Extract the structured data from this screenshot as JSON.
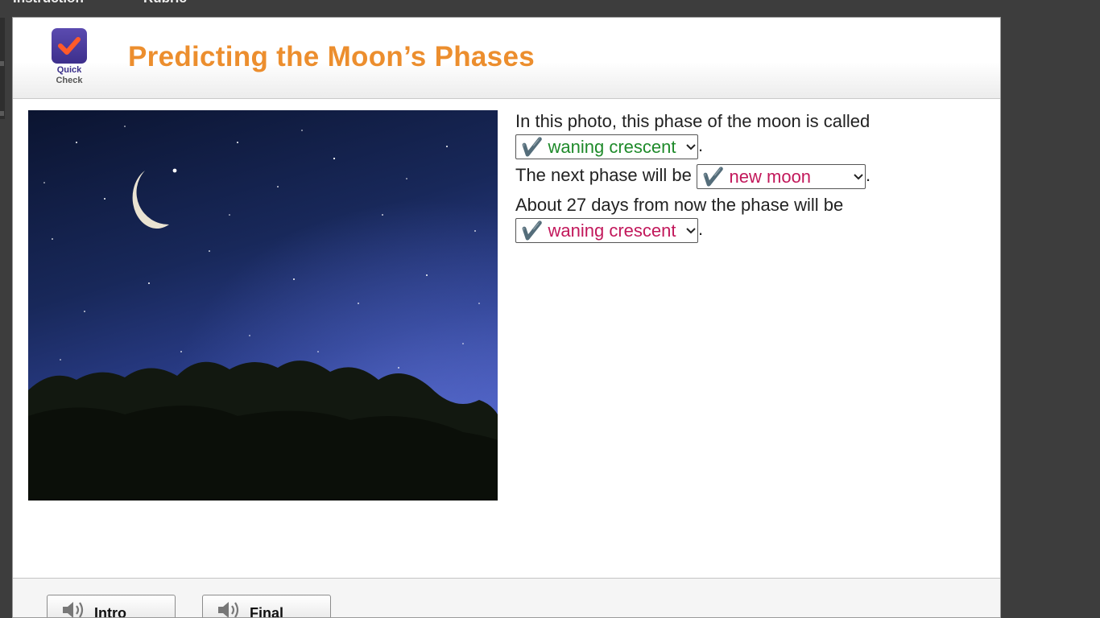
{
  "top_nav": {
    "item1": "Instruction",
    "item2": "Rubric"
  },
  "badge": {
    "line1": "Quick",
    "line2": "Check",
    "icon": "checkmark-icon"
  },
  "page_title": "Predicting the Moon’s Phases",
  "questions": [
    {
      "before": "In this photo, this phase of the moon is called",
      "selected": "✔️ waning crescent",
      "after": ".",
      "state": "correct"
    },
    {
      "before": "The next phase will be",
      "selected": "✔️ new moon",
      "after": ".",
      "state": "incorrect"
    },
    {
      "before": "About 27 days from now the phase will be",
      "selected": "✔️ waning crescent",
      "after": ".",
      "state": "incorrect"
    }
  ],
  "footer": {
    "intro_label": "Intro",
    "final_label": "Final",
    "icon": "speaker-icon"
  },
  "colors": {
    "title": "#ec8e2e",
    "correct": "#1e8a2a",
    "incorrect": "#c2185b",
    "badge": "#4a3b9e"
  }
}
